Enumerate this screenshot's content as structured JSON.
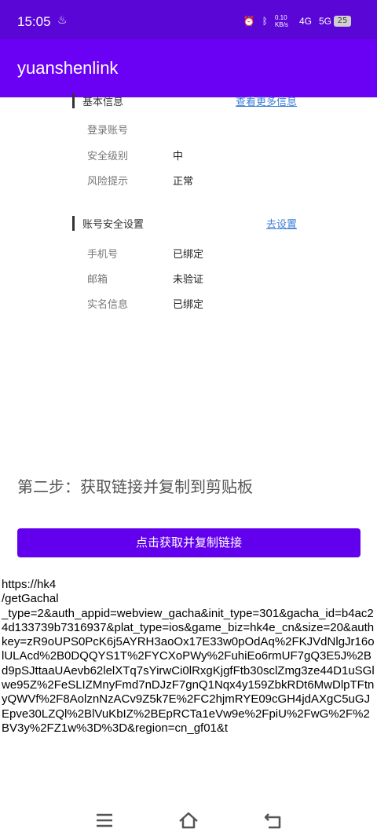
{
  "status_bar": {
    "time": "15:05",
    "net_speed": "0.10 KB/s",
    "signal_1": "4G",
    "signal_2": "5G",
    "battery": "25"
  },
  "app_bar": {
    "title": "yuanshenlink"
  },
  "basic_info": {
    "heading": "基本信息",
    "link": "查看更多信息",
    "rows": [
      {
        "label": "登录账号",
        "value": ""
      },
      {
        "label": "安全级别",
        "value": "中"
      },
      {
        "label": "风险提示",
        "value": "正常"
      }
    ]
  },
  "security": {
    "heading": "账号安全设置",
    "link": "去设置",
    "rows": [
      {
        "label": "手机号",
        "value": "已绑定"
      },
      {
        "label": "邮箱",
        "value": "未验证"
      },
      {
        "label": "实名信息",
        "value": "已绑定"
      }
    ]
  },
  "step2": {
    "title": "第二步：获取链接并复制到剪贴板",
    "button": "点击获取并复制链接"
  },
  "link_output": "https://hk4\n/getGachal\n_type=2&auth_appid=webview_gacha&init_type=301&gacha_id=b4ac24d133739b7316937&plat_type=ios&game_biz=hk4e_cn&size=20&authkey=zR9oUPS0PcK6j5AYRH3aoOx17E33w0pOdAq%2FKJVdNlgJr16olULAcd%2B0DQQYS1T%2FYCXoPWy%2FuhiEo6rmUF7gQ3E5J%2Bd9pSJttaaUAevb62lelXTq7sYirwCi0lRxgKjgfFtb30sclZmg3ze44D1uSGlwe95Z%2FeSLIZMnyFmd7nDJzF7gnQ1Nqx4y159ZbkRDt6MwDlpTFtnyQWVf%2F8AolznNzACv9Z5k7E%2FC2hjmRYE09cGH4jdAXgC5uGJEpve30LZQl%2BlVuKbIZ%2BEpRCTa1eVw9e%2FpiU%2FwG%2F%2BV3y%2FZ1w%3D%3D&region=cn_gf01&t"
}
